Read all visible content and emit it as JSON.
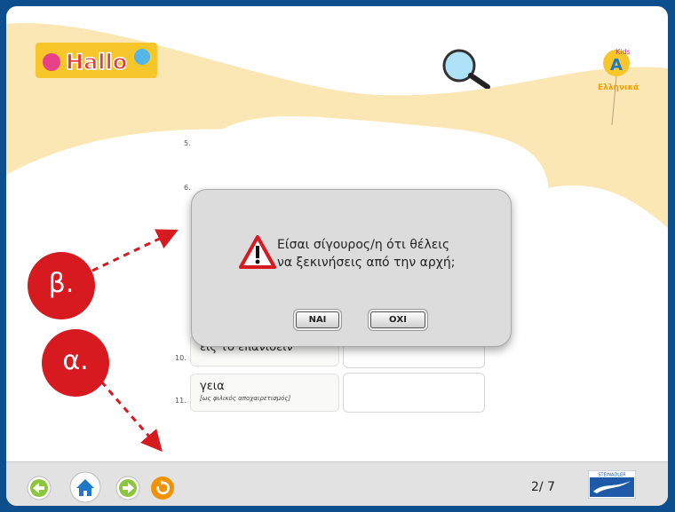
{
  "brand": {
    "hallo_logo": "Hallo",
    "kids_logo": "Kids A"
  },
  "icons": {
    "search": "magnifier-icon",
    "warning": "warning-triangle-icon",
    "back": "arrow-left-icon",
    "home": "home-icon",
    "forward": "arrow-right-icon",
    "restart": "restart-icon"
  },
  "rows": [
    {
      "num": "5."
    },
    {
      "num": "6."
    },
    {
      "num": "10.",
      "word": "εις το επανιδείν",
      "note": ""
    },
    {
      "num": "11.",
      "word": "γεια",
      "note": "[ως φιλικός αποχαιρετισμός]"
    }
  ],
  "dialog": {
    "line1": "Είσαι σίγουρος/η ότι θέλεις",
    "line2": "να ξεκινήσεις από την αρχή;",
    "yes_label": "ΝΑΙ",
    "no_label": "ΟΧΙ"
  },
  "annotations": {
    "beta": "β.",
    "alpha": "α."
  },
  "footer": {
    "page_indicator": "2/ 7",
    "publisher": "STEINADLER"
  },
  "colors": {
    "frame": "#0d4f8c",
    "swoosh": "#fbe7b4",
    "badge": "#d71920",
    "nav_green": "#8cc63f",
    "nav_home": "#1e78c8",
    "nav_orange": "#f39200"
  }
}
